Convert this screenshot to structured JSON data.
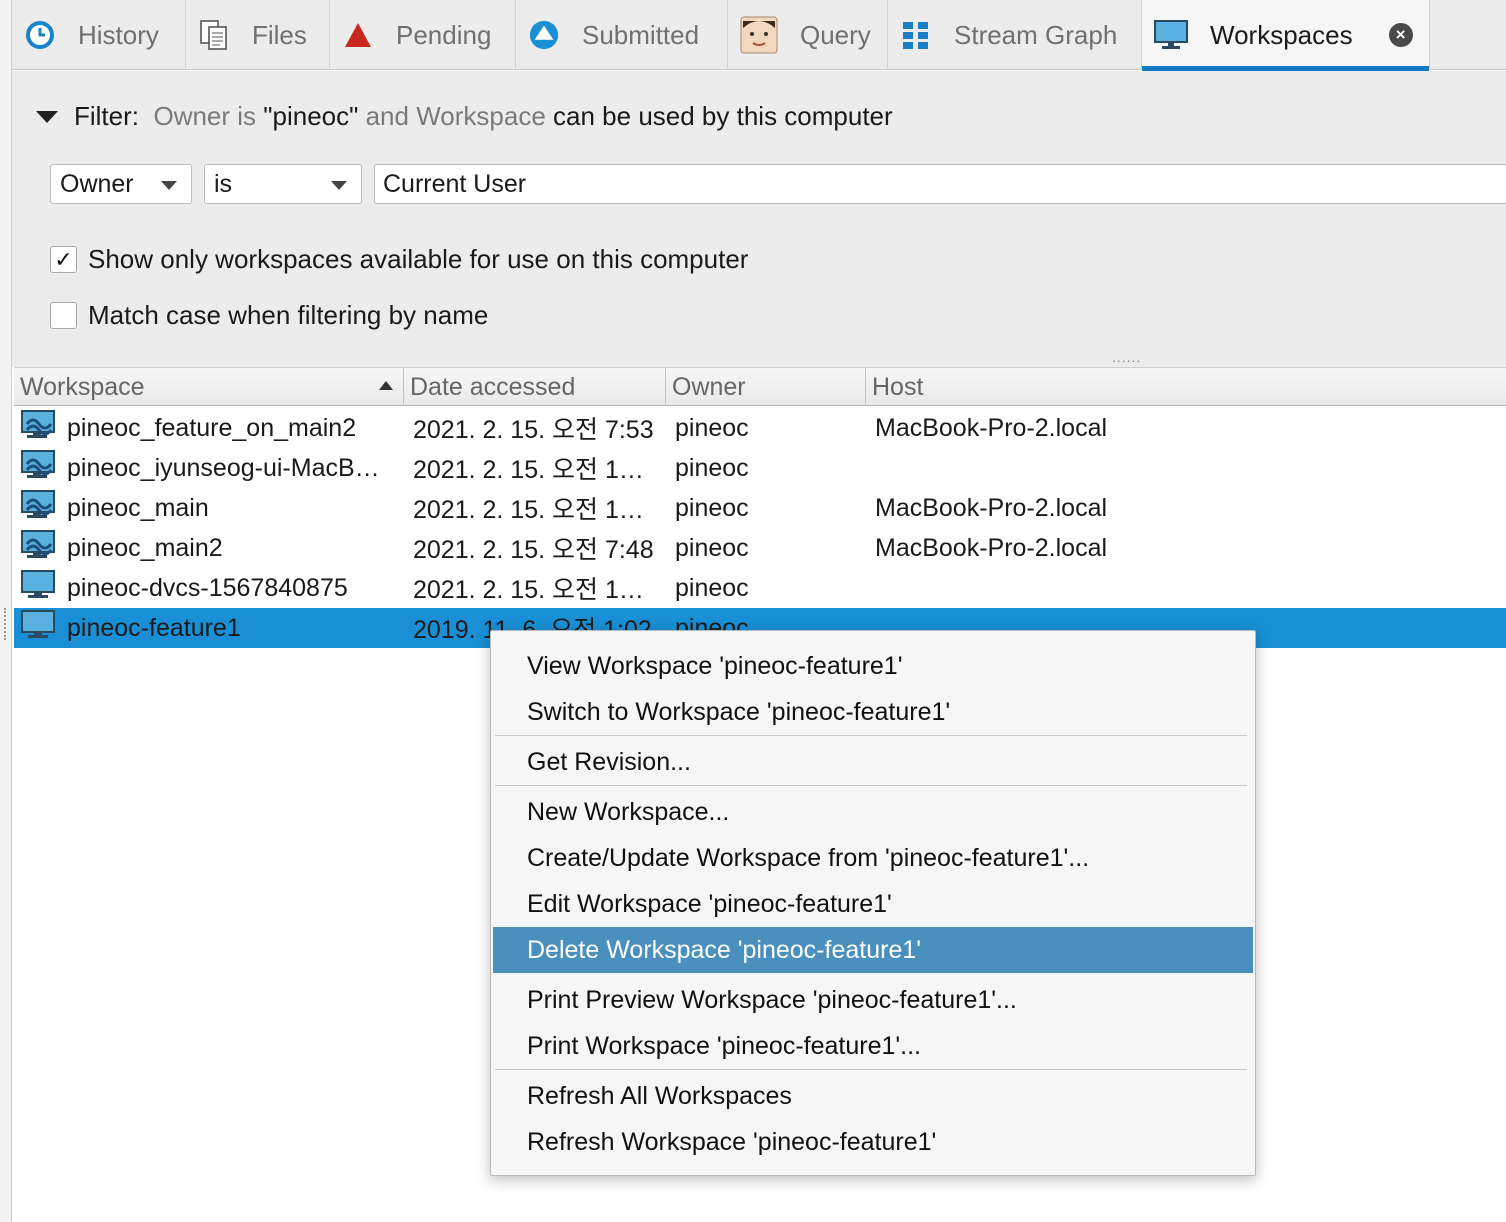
{
  "tabs": [
    {
      "label": "History",
      "icon": "clock-icon"
    },
    {
      "label": "Files",
      "icon": "files-icon"
    },
    {
      "label": "Pending",
      "icon": "pending-triangle-icon"
    },
    {
      "label": "Submitted",
      "icon": "submitted-arrow-icon"
    },
    {
      "label": "Query",
      "icon": "face-icon"
    },
    {
      "label": "Stream Graph",
      "icon": "grid-icon"
    },
    {
      "label": "Workspaces",
      "icon": "monitor-icon",
      "active": true
    }
  ],
  "filter": {
    "label": "Filter:",
    "summary_owner_is": "Owner is",
    "summary_owner_value": "\"pineoc\"",
    "summary_and": "and",
    "summary_workspace": "Workspace",
    "summary_rest": "can be used by this computer",
    "field_select": "Owner",
    "operator_select": "is",
    "value_input": "Current User",
    "show_available_label": "Show only workspaces available for use on this computer",
    "show_available_checked": true,
    "match_case_label": "Match case when filtering by name",
    "match_case_checked": false
  },
  "table": {
    "columns": [
      "Workspace",
      "Date accessed",
      "Owner",
      "Host"
    ],
    "sort_column": "Workspace",
    "sort_direction": "ascending",
    "rows": [
      {
        "workspace": "pineoc_feature_on_main2",
        "date": "2021. 2. 15. 오전 7:53",
        "owner": "pineoc",
        "host": "MacBook-Pro-2.local",
        "icon": "dvcs-workspace-icon"
      },
      {
        "workspace": "pineoc_iyunseog-ui-MacB…",
        "date": "2021. 2. 15. 오전 1…",
        "owner": "pineoc",
        "host": "",
        "icon": "dvcs-workspace-icon"
      },
      {
        "workspace": "pineoc_main",
        "date": "2021. 2. 15. 오전 1…",
        "owner": "pineoc",
        "host": "MacBook-Pro-2.local",
        "icon": "dvcs-workspace-icon"
      },
      {
        "workspace": "pineoc_main2",
        "date": "2021. 2. 15. 오전 7:48",
        "owner": "pineoc",
        "host": "MacBook-Pro-2.local",
        "icon": "dvcs-workspace-icon"
      },
      {
        "workspace": "pineoc-dvcs-1567840875",
        "date": "2021. 2. 15. 오전 1…",
        "owner": "pineoc",
        "host": "",
        "icon": "workspace-monitor-icon"
      },
      {
        "workspace": "pineoc-feature1",
        "date": "2019. 11. 6. 오전 1:02",
        "owner": "pineoc",
        "host": "",
        "icon": "workspace-monitor-icon",
        "selected": true
      }
    ]
  },
  "context_menu": {
    "items": [
      {
        "label": "View Workspace 'pineoc-feature1'"
      },
      {
        "label": "Switch to Workspace 'pineoc-feature1'"
      },
      {
        "label": "Get Revision..."
      },
      {
        "label": "New Workspace..."
      },
      {
        "label": "Create/Update Workspace from 'pineoc-feature1'..."
      },
      {
        "label": "Edit Workspace 'pineoc-feature1'"
      },
      {
        "label": "Delete Workspace 'pineoc-feature1'",
        "highlighted": true
      },
      {
        "label": "Print Preview Workspace 'pineoc-feature1'..."
      },
      {
        "label": "Print Workspace 'pineoc-feature1'..."
      },
      {
        "label": "Refresh All Workspaces"
      },
      {
        "label": "Refresh Workspace 'pineoc-feature1'"
      }
    ]
  },
  "colors": {
    "accent": "#0f7bc4",
    "selection": "#1a8fd6",
    "menu_highlight": "#4a90bf",
    "pending_red": "#c8281e"
  }
}
